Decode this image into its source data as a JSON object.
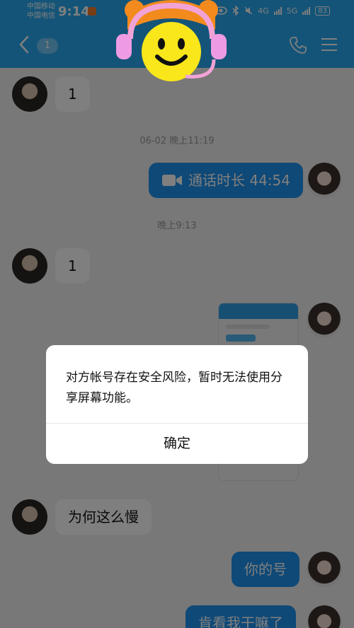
{
  "status_bar": {
    "carrier_1": "中国移动",
    "carrier_2": "中国电信",
    "time": "9:14",
    "network_1": "4G",
    "network_2": "5G",
    "battery": "83"
  },
  "nav": {
    "unread_count": "1",
    "icons": [
      "back-icon",
      "phone-icon",
      "menu-icon"
    ]
  },
  "messages": [
    {
      "side": "left",
      "text": "1"
    },
    {
      "side": "timestamp",
      "text": "06-02 晚上11:19"
    },
    {
      "side": "right",
      "type": "call",
      "text": "通话时长 44:54"
    },
    {
      "side": "timestamp",
      "text": "晚上9:13"
    },
    {
      "side": "left",
      "text": "1"
    },
    {
      "side": "right",
      "type": "image"
    },
    {
      "side": "left",
      "text": "为何这么慢"
    },
    {
      "side": "right",
      "text": "你的号"
    },
    {
      "side": "right",
      "text": "肯看我干嘛了"
    }
  ],
  "dialog": {
    "message": "对方帐号存在安全风险，暂时无法使用分享屏幕功能。",
    "confirm": "确定"
  },
  "colors": {
    "accent": "#29a9f0",
    "bubble_right": "#1f93ef",
    "overlay": "rgba(0,0,0,0.5)"
  }
}
